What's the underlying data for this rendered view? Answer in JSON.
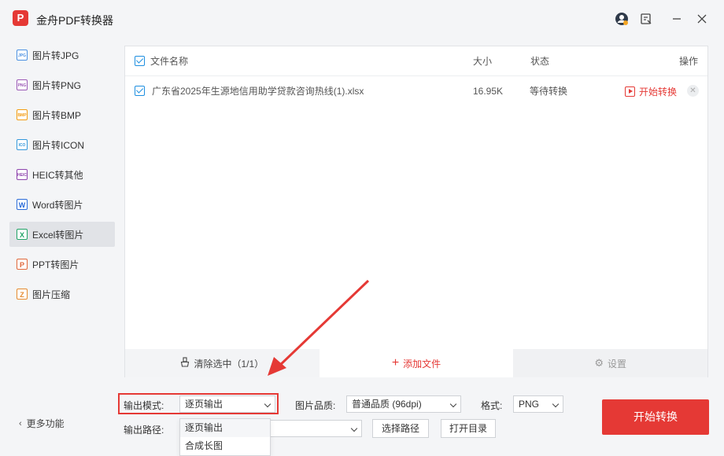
{
  "app": {
    "title": "金舟PDF转换器",
    "logo": "P"
  },
  "titlebar": {
    "icons": [
      "user-avatar-icon",
      "feedback-icon",
      "minimize-icon",
      "close-icon"
    ]
  },
  "sidebar": {
    "items": [
      {
        "label": "图片转JPG",
        "badge": "JPG",
        "color": "#4a90e2"
      },
      {
        "label": "图片转PNG",
        "badge": "PNG",
        "color": "#9b59b6"
      },
      {
        "label": "图片转BMP",
        "badge": "BMP",
        "color": "#f39c12"
      },
      {
        "label": "图片转ICON",
        "badge": "ICO",
        "color": "#3498db"
      },
      {
        "label": "HEIC转其他",
        "badge": "HEIC",
        "color": "#8e44ad"
      },
      {
        "label": "Word转图片",
        "badge": "W",
        "color": "#2b6cd8"
      },
      {
        "label": "Excel转图片",
        "badge": "X",
        "color": "#21a366"
      },
      {
        "label": "PPT转图片",
        "badge": "P",
        "color": "#e0673a"
      },
      {
        "label": "图片压缩",
        "badge": "Z",
        "color": "#e58a2e"
      }
    ],
    "active_index": 6,
    "more": "更多功能"
  },
  "table": {
    "headers": {
      "name": "文件名称",
      "size": "大小",
      "status": "状态",
      "action": "操作"
    },
    "rows": [
      {
        "name": "广东省2025年生源地信用助学贷款咨询热线(1).xlsx",
        "size": "16.95K",
        "status": "等待转换",
        "action": "开始转换"
      }
    ]
  },
  "bottom_bar": {
    "clear": "清除选中（1/1）",
    "add": "添加文件",
    "settings": "设置"
  },
  "options": {
    "mode_label": "输出模式:",
    "mode_value": "逐页输出",
    "mode_options": [
      "逐页输出",
      "合成长图"
    ],
    "quality_label": "图片品质:",
    "quality_value": "普通品质 (96dpi)",
    "format_label": "格式:",
    "format_value": "PNG",
    "path_label": "输出路径:",
    "path_value": "",
    "choose_path": "选择路径",
    "open_dir": "打开目录"
  },
  "start_button": "开始转换",
  "colors": {
    "accent": "#e53935",
    "check": "#1e8fe0",
    "active_item": "#e1e3e7"
  }
}
